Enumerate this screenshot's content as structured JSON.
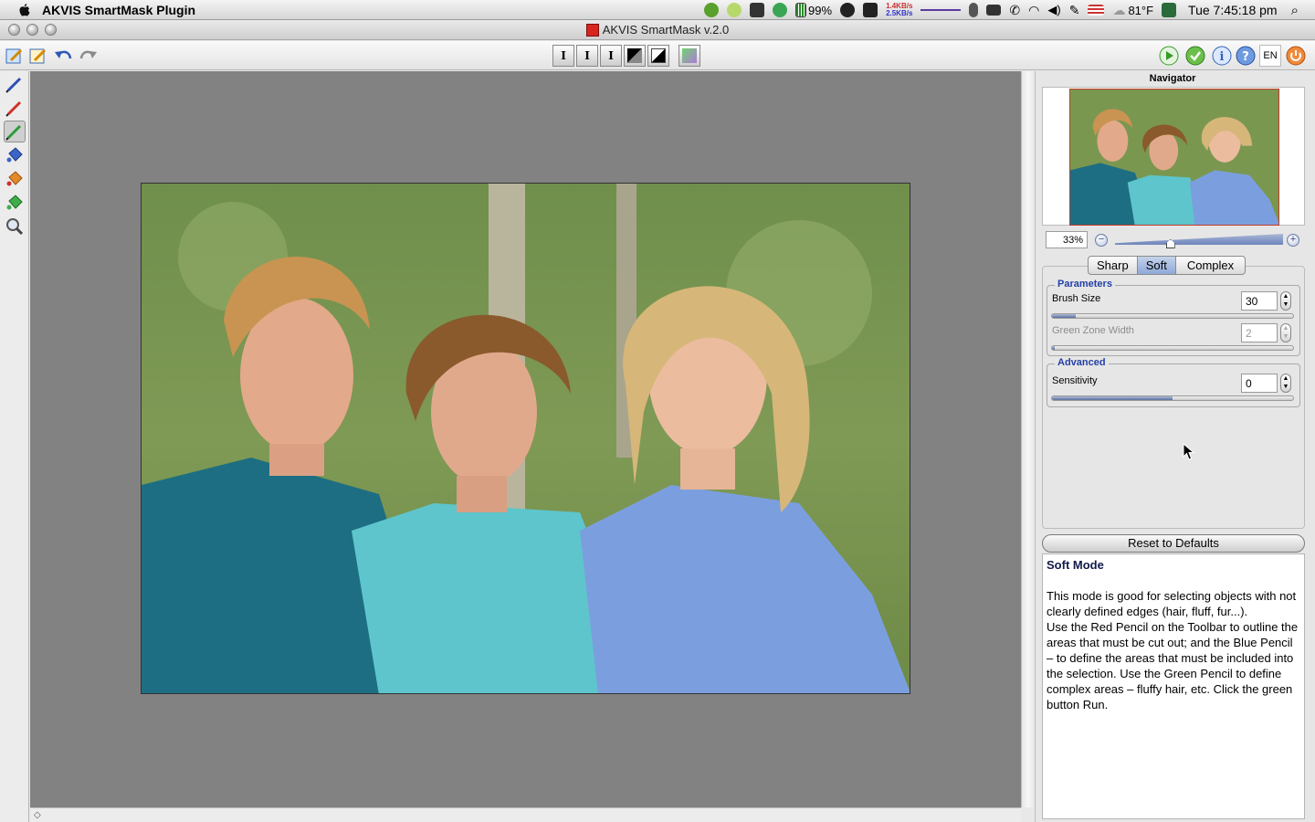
{
  "menubar": {
    "app_name": "AKVIS SmartMask Plugin",
    "net_up": "1.4KB/s",
    "net_down": "2.5KB/s",
    "battery": "99%",
    "temperature": "81°F",
    "clock": "Tue 7:45:18 pm"
  },
  "window": {
    "title": "AKVIS SmartMask v.2.0"
  },
  "toolbar": {
    "mode_icons": [
      "I",
      "I",
      "I",
      "mask-icon",
      "contrast-icon",
      "green-mask-icon"
    ],
    "language": "EN"
  },
  "tools": [
    "blue-pencil-icon",
    "red-pencil-icon",
    "green-pencil-icon",
    "blue-bucket-icon",
    "red-bucket-icon",
    "green-bucket-icon",
    "magnifier-icon"
  ],
  "navigator": {
    "title": "Navigator",
    "zoom": "33%",
    "zoom_level": 0.33
  },
  "tabs": [
    {
      "label": "Sharp",
      "selected": false
    },
    {
      "label": "Soft",
      "selected": true
    },
    {
      "label": "Complex",
      "selected": false
    }
  ],
  "parameters": {
    "legend": "Parameters",
    "brush_size": {
      "label": "Brush Size",
      "value": "30",
      "fraction": 0.1
    },
    "green_zone": {
      "label": "Green Zone Width",
      "value": "2",
      "fraction": 0.01
    }
  },
  "advanced": {
    "legend": "Advanced",
    "sensitivity": {
      "label": "Sensitivity",
      "value": "0",
      "fraction": 0.5
    }
  },
  "reset_label": "Reset to Defaults",
  "help": {
    "title": "Soft Mode",
    "p1": "This mode is good for selecting objects with not clearly defined edges (hair, fluff, fur...).",
    "p2": "Use the Red Pencil on the Toolbar to outline the areas that must be cut out; and the Blue Pencil – to define the areas that must be included into the selection. Use the Green Pencil to define complex areas – fluffy hair, etc. Click the green button Run."
  }
}
